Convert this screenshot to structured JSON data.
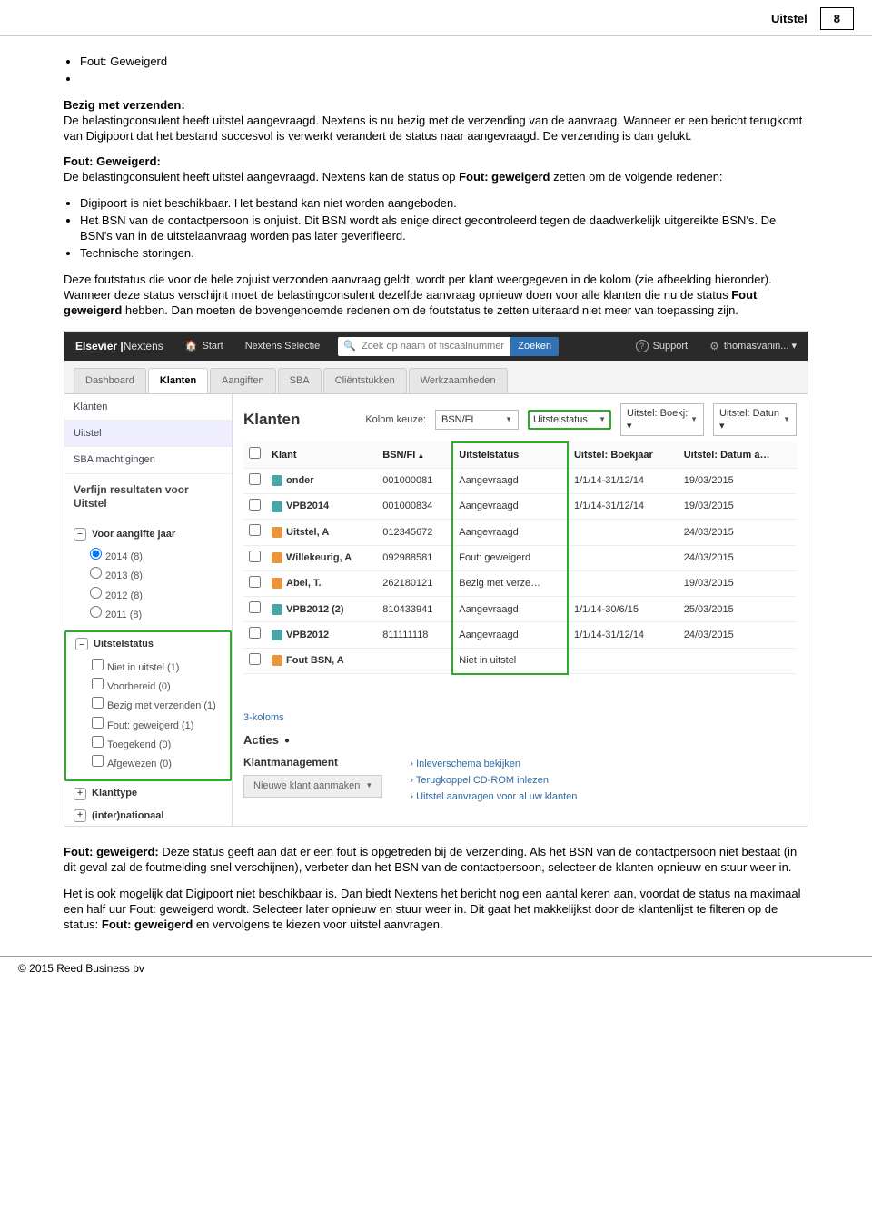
{
  "header": {
    "title": "Uitstel",
    "page": "8"
  },
  "doc": {
    "b1": "Fout: Geweigerd",
    "b2_h": "Bezig met verzenden:",
    "b2": "De belastingconsulent heeft uitstel aangevraagd. Nextens is nu bezig met de verzending van de aanvraag. Wanneer er een bericht terugkomt van Digipoort dat het bestand succesvol is verwerkt verandert de status naar aangevraagd. De verzending is dan gelukt.",
    "b3_h": "Fout: Geweigerd:",
    "b3": "De belastingconsulent heeft uitstel aangevraagd. Nextens kan de status op ",
    "b3b": "Fout: geweigerd",
    "b3c": " zetten om de volgende redenen:",
    "li1": "Digipoort is niet beschikbaar. Het bestand kan niet worden aangeboden.",
    "li2": "Het BSN van de contactpersoon is onjuist. Dit BSN wordt als enige direct gecontroleerd tegen de daadwerkelijk uitgereikte BSN's. De BSN's van in de uitstelaanvraag worden pas later geverifieerd.",
    "li3": "Technische storingen.",
    "p4": "Deze foutstatus die voor de hele zojuist verzonden aanvraag geldt, wordt per klant weergegeven in de kolom (zie afbeelding hieronder). Wanneer deze status verschijnt moet de belastingconsulent dezelfde aanvraag opnieuw doen voor alle klanten die nu de status ",
    "p4b": "Fout geweigerd",
    "p4c": " hebben. Dan moeten de bovengenoemde redenen om de foutstatus te zetten uiteraard niet meer van toepassing zijn.",
    "p5_h": "Fout: geweigerd:",
    "p5": " Deze status geeft aan dat er een fout is opgetreden bij de verzending. Als het BSN van de contactpersoon niet bestaat (in dit geval zal de foutmelding snel verschijnen), verbeter dan het BSN van de contactpersoon, selecteer de klanten opnieuw en stuur weer in.",
    "p6a": "Het is ook mogelijk dat Digipoort niet beschikbaar is. Dan biedt Nextens het bericht nog een aantal keren aan, voordat de status na maximaal een half uur Fout: geweigerd wordt. Selecteer later opnieuw en stuur weer in.",
    "p6b": "Dit gaat het makkelijkst door de klantenlijst te filteren op de status: ",
    "p6c": "Fout: geweigerd",
    "p6d": " en vervolgens te kiezen voor uitstel aanvragen."
  },
  "shot": {
    "brand_l": "Elsevier",
    "brand_r": "Nextens",
    "start": "Start",
    "selectie": "Nextens Selectie",
    "search_ph": "Zoek op naam of fiscaalnummer",
    "zoeken": "Zoeken",
    "support": "Support",
    "user": "thomasvanin... ▾",
    "tabs": {
      "t0": "Dashboard",
      "t1": "Klanten",
      "t2": "Aangiften",
      "t3": "SBA",
      "t4": "Cliëntstukken",
      "t5": "Werkzaamheden"
    },
    "side": {
      "s0": "Klanten",
      "s1": "Uitstel",
      "s2": "SBA machtigingen",
      "verfijn": "Verfijn resultaten voor Uitstel",
      "f1h": "Voor aangifte jaar",
      "f1": {
        "a": "2014 (8)",
        "b": "2013 (8)",
        "c": "2012 (8)",
        "d": "2011 (8)"
      },
      "f2h": "Uitstelstatus",
      "f2": {
        "a": "Niet in uitstel (1)",
        "b": "Voorbereid (0)",
        "c": "Bezig met verzenden (1)",
        "d": "Fout: geweigerd (1)",
        "e": "Toegekend (0)",
        "f": "Afgewezen (0)"
      },
      "f3h": "Klanttype",
      "f4h": "(inter)nationaal"
    },
    "main": {
      "title": "Klanten",
      "kolom": "Kolom keuze:",
      "dd1": "BSN/FI",
      "dd2": "Uitstelstatus",
      "dd3": "Uitstel: Boekj: ▾",
      "dd4": "Uitstel: Datun ▾",
      "th_klant": "Klant",
      "th_bsn": "BSN/FI",
      "th_stat": "Uitstelstatus",
      "th_boek": "Uitstel: Boekjaar",
      "th_datum": "Uitstel: Datum a…",
      "rows": [
        {
          "ic": "org",
          "k": "onder",
          "b": "001000081",
          "s": "Aangevraagd",
          "bj": "1/1/14-31/12/14",
          "d": "19/03/2015"
        },
        {
          "ic": "org",
          "k": "VPB2014",
          "b": "001000834",
          "s": "Aangevraagd",
          "bj": "1/1/14-31/12/14",
          "d": "19/03/2015"
        },
        {
          "ic": "per",
          "k": "Uitstel, A",
          "b": "012345672",
          "s": "Aangevraagd",
          "bj": "",
          "d": "24/03/2015"
        },
        {
          "ic": "per",
          "k": "Willekeurig, A",
          "b": "092988581",
          "s": "Fout: geweigerd",
          "bj": "",
          "d": "24/03/2015"
        },
        {
          "ic": "per",
          "k": "Abel, T.",
          "b": "262180121",
          "s": "Bezig met verze…",
          "bj": "",
          "d": "19/03/2015"
        },
        {
          "ic": "org",
          "k": "VPB2012 (2)",
          "b": "810433941",
          "s": "Aangevraagd",
          "bj": "1/1/14-30/6/15",
          "d": "25/03/2015"
        },
        {
          "ic": "org",
          "k": "VPB2012",
          "b": "811111118",
          "s": "Aangevraagd",
          "bj": "1/1/14-31/12/14",
          "d": "24/03/2015"
        },
        {
          "ic": "per",
          "k": "Fout BSN, A",
          "b": "",
          "s": "Niet in uitstel",
          "bj": "",
          "d": ""
        }
      ],
      "threek": "3-koloms",
      "acties": "Acties",
      "km": "Klantmanagement",
      "niew": "Nieuwe klant aanmaken",
      "a1": "Inleverschema bekijken",
      "a2": "Terugkoppel CD-ROM inlezen",
      "a3": "Uitstel aanvragen voor al uw klanten"
    }
  },
  "footer": "© 2015 Reed Business bv"
}
